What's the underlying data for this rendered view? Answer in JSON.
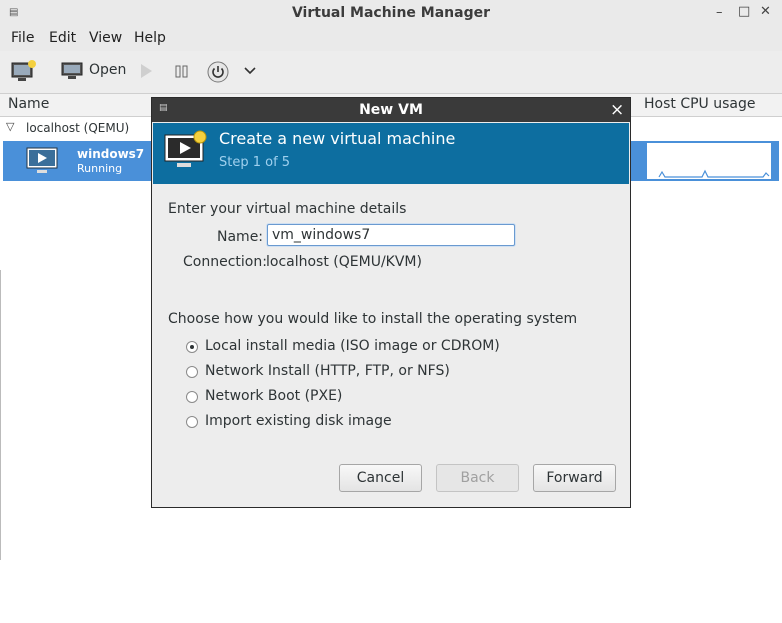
{
  "window": {
    "title": "Virtual Machine Manager",
    "controls": {
      "minimize": "–",
      "maximize": "□",
      "close": "✕"
    }
  },
  "menu": [
    "File",
    "Edit",
    "View",
    "Help"
  ],
  "toolbar": {
    "open_label": "Open"
  },
  "columns": {
    "name": "Name",
    "host_cpu": "Host CPU usage"
  },
  "tree": {
    "connection": "localhost (QEMU)",
    "vm": {
      "name": "windows7",
      "status": "Running"
    }
  },
  "dialog": {
    "title": "New VM",
    "close": "×",
    "banner_title": "Create a new virtual machine",
    "step": "Step 1 of 5",
    "details_heading": "Enter your virtual machine details",
    "name_label": "Name:",
    "name_value": "vm_windows7",
    "connection_label": "Connection:",
    "connection_value": "localhost (QEMU/KVM)",
    "install_heading": "Choose how you would like to install the operating system",
    "options": [
      {
        "label": "Local install media (ISO image or CDROM)",
        "selected": true
      },
      {
        "label": "Network Install (HTTP, FTP, or NFS)",
        "selected": false
      },
      {
        "label": "Network Boot (PXE)",
        "selected": false
      },
      {
        "label": "Import existing disk image",
        "selected": false
      }
    ],
    "buttons": {
      "cancel": "Cancel",
      "back": "Back",
      "forward": "Forward"
    }
  },
  "colors": {
    "banner": "#0d6ea0",
    "selection": "#4a90d9",
    "dialog_title_bar": "#3a3a3a"
  }
}
